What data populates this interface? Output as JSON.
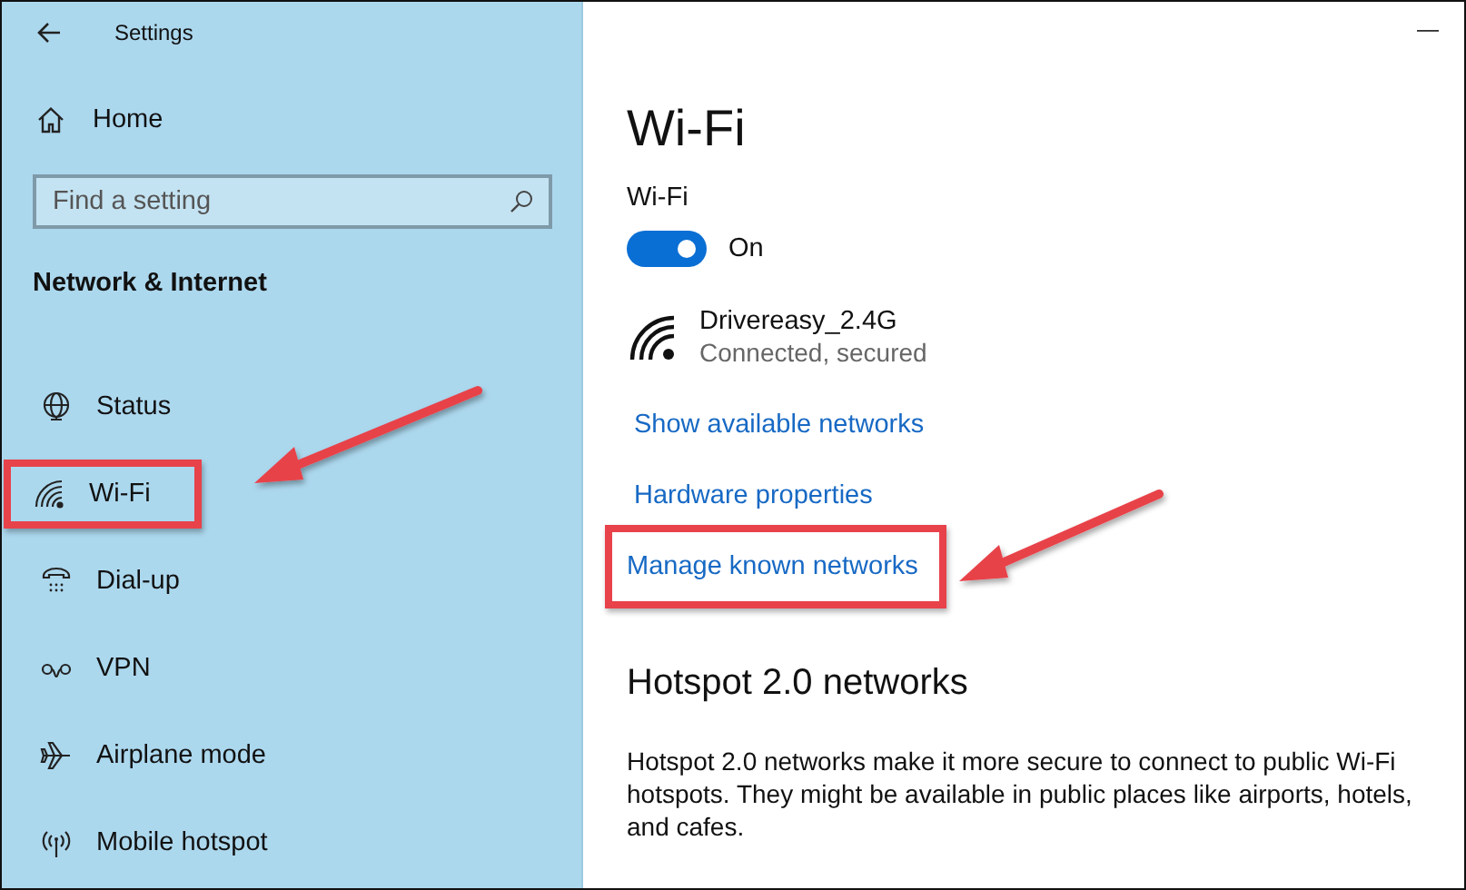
{
  "window": {
    "title": "Settings",
    "minimize": "—"
  },
  "sidebar": {
    "home": "Home",
    "search": {
      "placeholder": "Find a setting"
    },
    "section": "Network & Internet",
    "items": [
      {
        "kind": "status",
        "label": "Status",
        "highlighted": false
      },
      {
        "kind": "wifi",
        "label": "Wi-Fi",
        "highlighted": true
      },
      {
        "kind": "dialup",
        "label": "Dial-up",
        "highlighted": false
      },
      {
        "kind": "vpn",
        "label": "VPN",
        "highlighted": false
      },
      {
        "kind": "airplane",
        "label": "Airplane mode",
        "highlighted": false
      },
      {
        "kind": "hotspot",
        "label": "Mobile hotspot",
        "highlighted": false
      }
    ]
  },
  "main": {
    "title": "Wi-Fi",
    "toggle": {
      "label": "Wi-Fi",
      "on": true,
      "state_text": "On"
    },
    "network": {
      "name": "Drivereasy_2.4G",
      "status": "Connected, secured"
    },
    "links": [
      {
        "label": "Show available networks",
        "highlighted": false
      },
      {
        "label": "Hardware properties",
        "highlighted": false
      },
      {
        "label": "Manage known networks",
        "highlighted": true
      }
    ],
    "hotspot": {
      "heading": "Hotspot 2.0 networks",
      "text": "Hotspot 2.0 networks make it more secure to connect to public Wi-Fi hotspots. They might be available in public places like airports, hotels, and cafes."
    }
  }
}
